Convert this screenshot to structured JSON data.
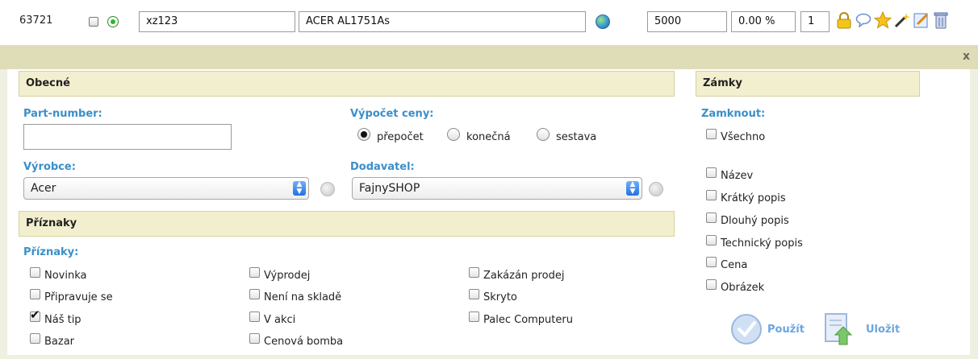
{
  "row": {
    "id": "63721",
    "code": "xz123",
    "name": "ACER AL1751As",
    "price": "5000",
    "discount": "0.00 %",
    "qty": "1"
  },
  "icons": [
    "lock-icon",
    "comment-icon",
    "star-icon",
    "magic-wand-icon",
    "edit-icon",
    "trash-icon"
  ],
  "panel": {
    "close": "x"
  },
  "obecne": {
    "title": "Obecné",
    "part_label": "Part-number:",
    "part_value": "",
    "price_calc_label": "Výpočet ceny:",
    "price_calc_options": [
      "přepočet",
      "konečná",
      "sestava"
    ],
    "price_calc_selected": "přepočet",
    "vyrobce_label": "Výrobce:",
    "vyrobce_value": "Acer",
    "dodavatel_label": "Dodavatel:",
    "dodavatel_value": "FajnySHOP"
  },
  "priznaky": {
    "title": "Příznaky",
    "label": "Příznaky:",
    "col1": [
      "Novinka",
      "Připravuje se",
      "Náš tip",
      "Bazar"
    ],
    "col2": [
      "Výprodej",
      "Není na skladě",
      "V akci",
      "Cenová bomba"
    ],
    "col3": [
      "Zakázán prodej",
      "Skryto",
      "Palec Computeru"
    ],
    "checked": [
      "Náš tip"
    ]
  },
  "zamky": {
    "title": "Zámky",
    "label": "Zamknout:",
    "all": "Všechno",
    "items": [
      "Název",
      "Krátký popis",
      "Dlouhý popis",
      "Technický popis",
      "Cena",
      "Obrázek"
    ]
  },
  "actions": {
    "apply": "Použít",
    "save": "Uložit"
  },
  "colors": {
    "label_blue": "#3a8fc9",
    "header_bg": "#f2efcf",
    "panel_bg": "#dfdcb8"
  }
}
